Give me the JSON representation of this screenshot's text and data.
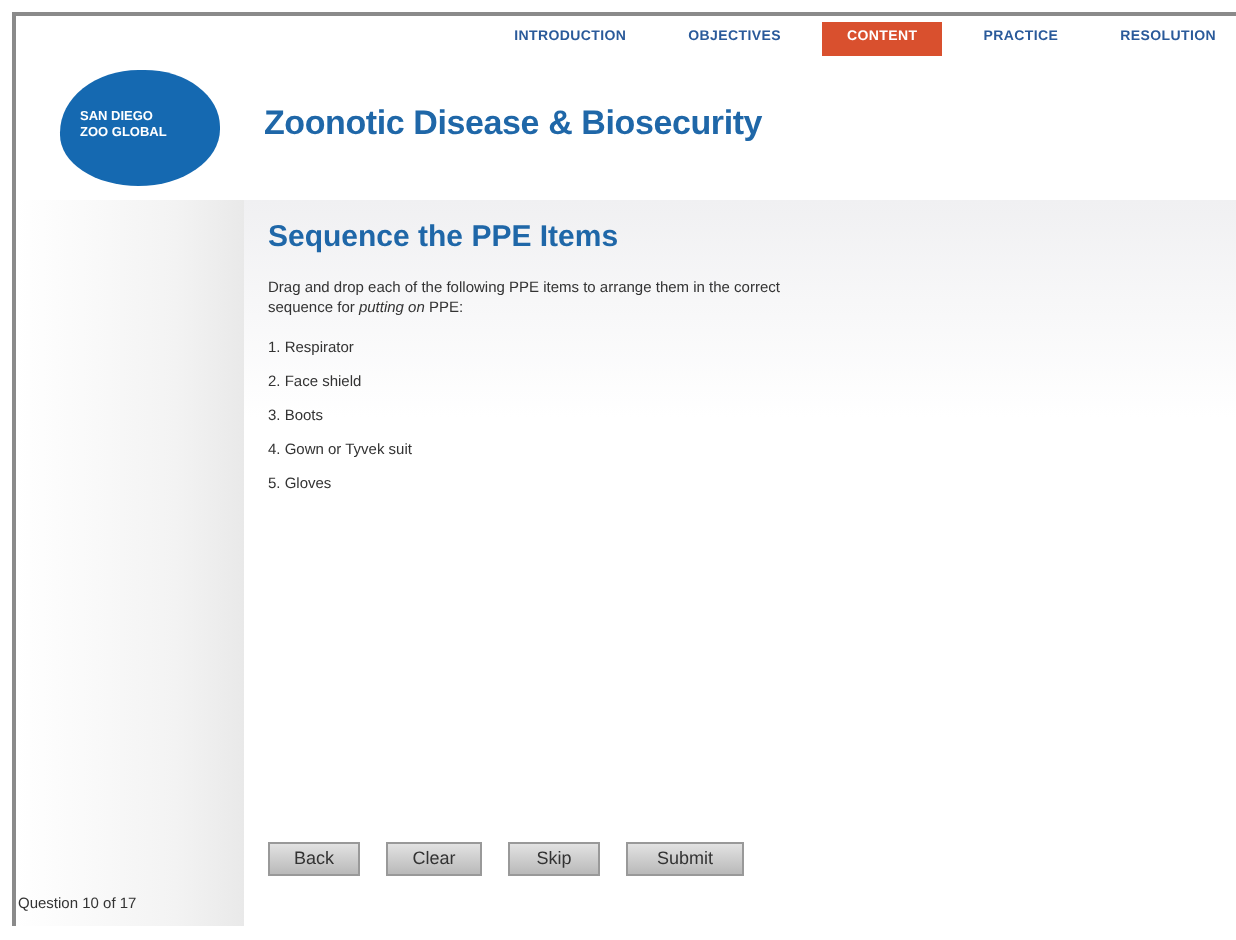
{
  "nav": [
    {
      "label": "INTRODUCTION",
      "selected": false
    },
    {
      "label": "OBJECTIVES",
      "selected": false
    },
    {
      "label": "CONTENT",
      "selected": true
    },
    {
      "label": "PRACTICE",
      "selected": false
    },
    {
      "label": "RESOLUTION",
      "selected": false
    }
  ],
  "logo": "SAN DIEGO ZOO GLOBAL",
  "course_title": "Zoonotic Disease & Biosecurity",
  "heading": "Sequence the PPE Items",
  "instructions": "Drag and drop each of the following PPE items to arrange them in the correct sequence for *putting on* PPE:",
  "items": [
    "1. Respirator",
    "2. Face shield",
    "3. Boots",
    "4. Gown or Tyvek suit",
    "5. Gloves"
  ],
  "buttons": [
    "Back",
    "Clear",
    "Skip",
    "Submit"
  ],
  "progress": "Question 10 of 17"
}
